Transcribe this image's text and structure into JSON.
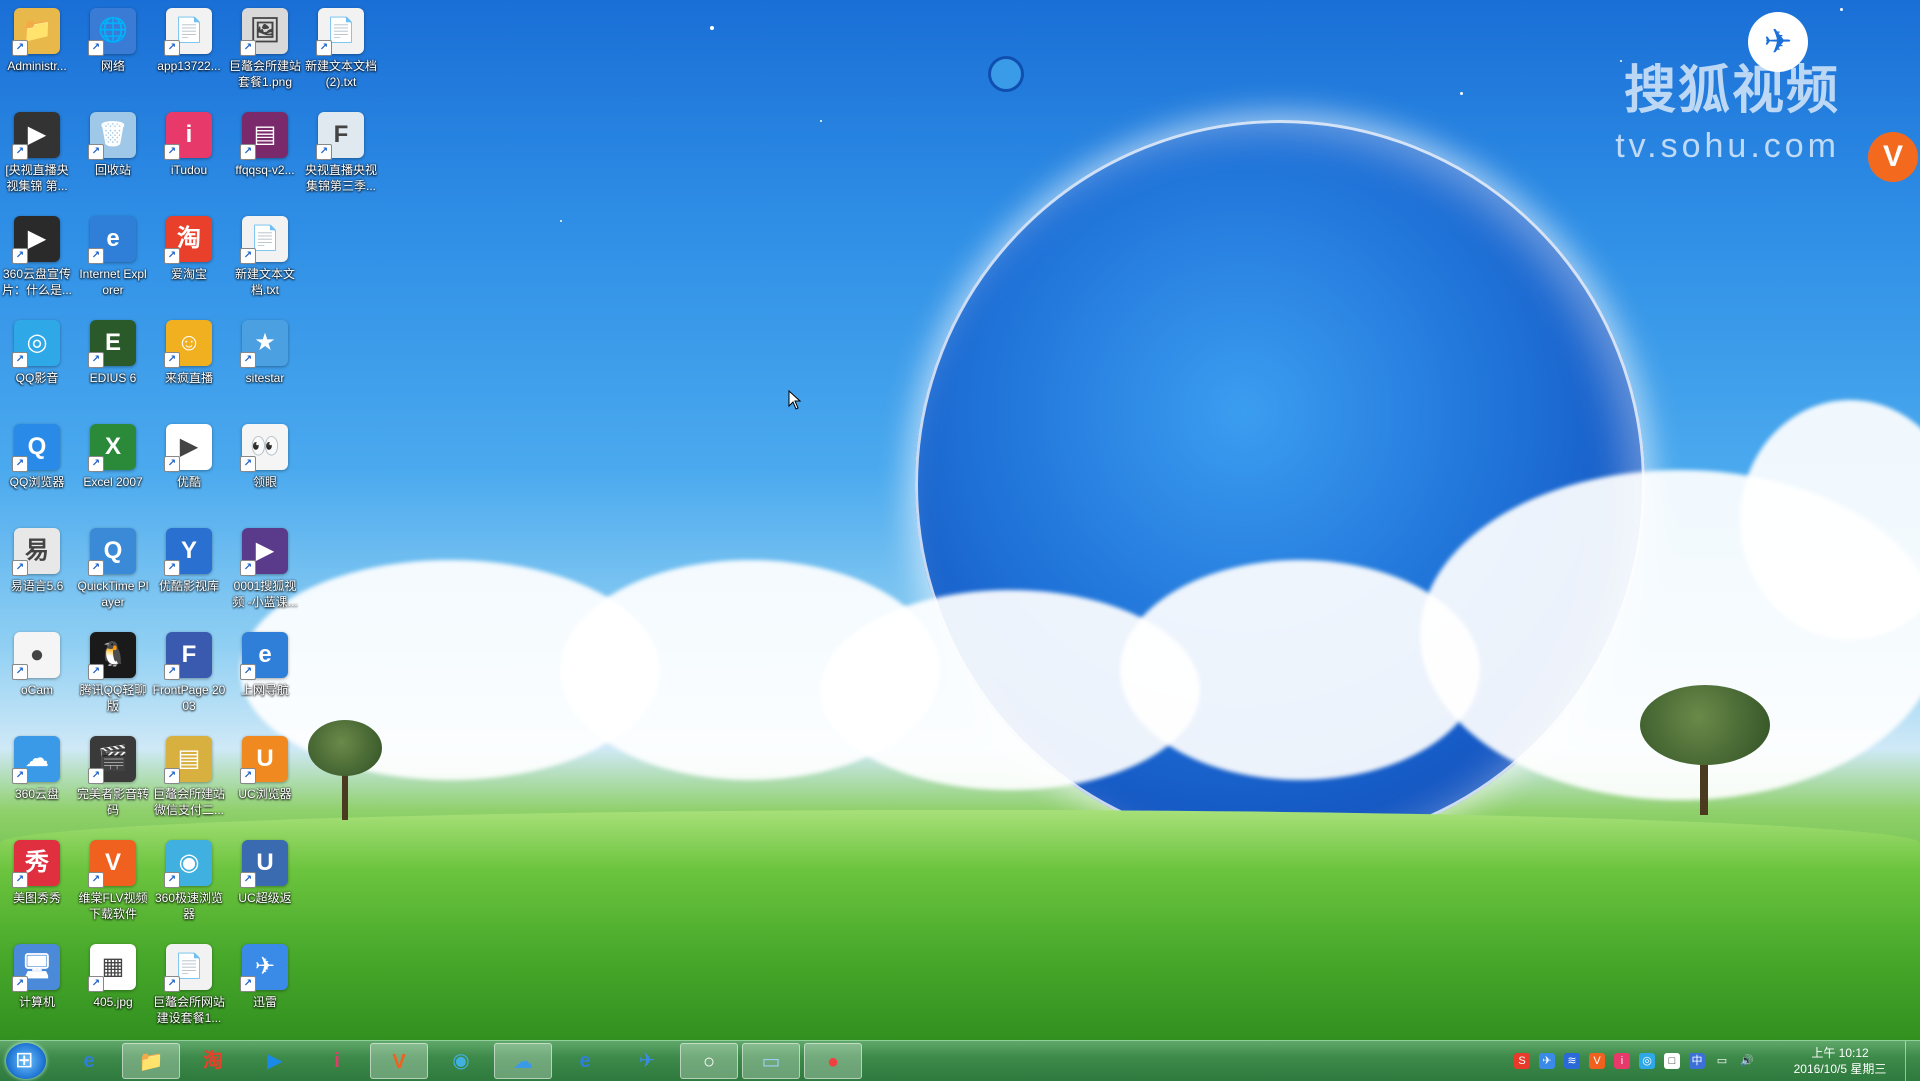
{
  "watermark": {
    "title": "搜狐视频",
    "url": "tv.sohu.com"
  },
  "desktop_icons": [
    {
      "label": "Administr...",
      "icon": "folder-icon",
      "color": "#e8b84a",
      "glyph": "📁"
    },
    {
      "label": "网络",
      "icon": "network-icon",
      "color": "#3a7bd5",
      "glyph": "🌐"
    },
    {
      "label": "app13722...",
      "icon": "file-icon",
      "color": "#f2f2f2",
      "glyph": "📄"
    },
    {
      "label": "巨鼇会所建站套餐1.png",
      "icon": "image-file-icon",
      "color": "#d9d9d9",
      "glyph": "🖼"
    },
    {
      "label": "新建文本文档(2).txt",
      "icon": "text-file-icon",
      "color": "#f2f2f2",
      "glyph": "📄"
    },
    {
      "label": "[央视直播央视集锦 第...",
      "icon": "video-file-icon",
      "color": "#333333",
      "glyph": "▶"
    },
    {
      "label": "回收站",
      "icon": "recycle-bin-icon",
      "color": "#9fc7e8",
      "glyph": "🗑"
    },
    {
      "label": "iTudou",
      "icon": "itudou-icon",
      "color": "#e83a6a",
      "glyph": "i"
    },
    {
      "label": "ffqqsq-v2...",
      "icon": "archive-icon",
      "color": "#7a2a6a",
      "glyph": "▤"
    },
    {
      "label": "央视直播央视集锦第三季...",
      "icon": "flv-file-icon",
      "color": "#e0e8f0",
      "glyph": "F"
    },
    {
      "label": "360云盘宣传片：什么是...",
      "icon": "video-file-icon",
      "color": "#2a2a2a",
      "glyph": "▶"
    },
    {
      "label": "Internet Explorer",
      "icon": "ie-icon",
      "color": "#2f7fd8",
      "glyph": "e"
    },
    {
      "label": "爱淘宝",
      "icon": "taobao-icon",
      "color": "#e8402a",
      "glyph": "淘"
    },
    {
      "label": "新建文本文档.txt",
      "icon": "text-file-icon",
      "color": "#f2f2f2",
      "glyph": "📄"
    },
    {
      "label": "QQ影音",
      "icon": "qq-player-icon",
      "color": "#2fa8e8",
      "glyph": "◎"
    },
    {
      "label": "EDIUS 6",
      "icon": "edius-icon",
      "color": "#2a5a2a",
      "glyph": "E"
    },
    {
      "label": "来疯直播",
      "icon": "laifeng-icon",
      "color": "#f0b020",
      "glyph": "☺"
    },
    {
      "label": "sitestar",
      "icon": "sitestar-icon",
      "color": "#4aa0e0",
      "glyph": "★"
    },
    {
      "label": "QQ浏览器",
      "icon": "qq-browser-icon",
      "color": "#2a8ae8",
      "glyph": "Q"
    },
    {
      "label": "Excel 2007",
      "icon": "excel-icon",
      "color": "#2a8a3a",
      "glyph": "X"
    },
    {
      "label": "优酷",
      "icon": "youku-icon",
      "color": "#ffffff",
      "glyph": "▶"
    },
    {
      "label": "领眼",
      "icon": "lingyan-icon",
      "color": "#f5f5f5",
      "glyph": "👀"
    },
    {
      "label": "易语言5.6",
      "icon": "eyuyan-icon",
      "color": "#e8e8e8",
      "glyph": "易"
    },
    {
      "label": "QuickTime Player",
      "icon": "quicktime-icon",
      "color": "#3a8ad8",
      "glyph": "Q"
    },
    {
      "label": "优酷影视库",
      "icon": "youku-library-icon",
      "color": "#2a70d0",
      "glyph": "Y"
    },
    {
      "label": "0001搜狐视频 -小蓝课...",
      "icon": "video-file-icon",
      "color": "#5a3a8a",
      "glyph": "▶"
    },
    {
      "label": "oCam",
      "icon": "ocam-icon",
      "color": "#f5f5f5",
      "glyph": "●"
    },
    {
      "label": "腾讯QQ轻聊版",
      "icon": "qq-icon",
      "color": "#1a1a1a",
      "glyph": "🐧"
    },
    {
      "label": "FrontPage 2003",
      "icon": "frontpage-icon",
      "color": "#3a5ab0",
      "glyph": "F"
    },
    {
      "label": "上网导航",
      "icon": "ie-icon",
      "color": "#2f7fd8",
      "glyph": "e"
    },
    {
      "label": "360云盘",
      "icon": "cloud-drive-icon",
      "color": "#3a9ae8",
      "glyph": "☁"
    },
    {
      "label": "完美者影音转码",
      "icon": "clapperboard-icon",
      "color": "#3a3a3a",
      "glyph": "🎬"
    },
    {
      "label": "巨鼇会所建站微信支付二...",
      "icon": "archive-icon",
      "color": "#d8b040",
      "glyph": "▤"
    },
    {
      "label": "UC浏览器",
      "icon": "uc-browser-icon",
      "color": "#f08a20",
      "glyph": "U"
    },
    {
      "label": "美图秀秀",
      "icon": "meitu-icon",
      "color": "#e03040",
      "glyph": "秀"
    },
    {
      "label": "维棠FLV视频下载软件",
      "icon": "weitang-icon",
      "color": "#f0601f",
      "glyph": "V"
    },
    {
      "label": "360极速浏览器",
      "icon": "360-browser-icon",
      "color": "#40b0e0",
      "glyph": "◉"
    },
    {
      "label": "UC超级返",
      "icon": "uc-super-icon",
      "color": "#3a6ab0",
      "glyph": "U"
    },
    {
      "label": "计算机",
      "icon": "computer-icon",
      "color": "#4a8ad8",
      "glyph": "🖥"
    },
    {
      "label": "405.jpg",
      "icon": "qr-image-icon",
      "color": "#ffffff",
      "glyph": "▦"
    },
    {
      "label": "巨鼇会所网站建设套餐1...",
      "icon": "text-file-icon",
      "color": "#f2f2f2",
      "glyph": "📄"
    },
    {
      "label": "迅雷",
      "icon": "xunlei-icon",
      "color": "#3a8ae8",
      "glyph": "✈"
    }
  ],
  "taskbar": {
    "items": [
      {
        "name": "ie-taskbar-icon",
        "glyph": "e",
        "color": "#2f7fd8",
        "active": false
      },
      {
        "name": "explorer-taskbar-icon",
        "glyph": "📁",
        "color": "#e8b84a",
        "active": true
      },
      {
        "name": "taobao-taskbar-icon",
        "glyph": "淘",
        "color": "#e8402a",
        "active": false
      },
      {
        "name": "youku-taskbar-icon",
        "glyph": "▶",
        "color": "#1a8ae8",
        "active": false
      },
      {
        "name": "itudou-taskbar-icon",
        "glyph": "i",
        "color": "#e83a6a",
        "active": false
      },
      {
        "name": "weitang-taskbar-icon",
        "glyph": "V",
        "color": "#f0601f",
        "active": true
      },
      {
        "name": "360-browser-taskbar-icon",
        "glyph": "◉",
        "color": "#40b0e0",
        "active": false
      },
      {
        "name": "cloud-drive-taskbar-icon",
        "glyph": "☁",
        "color": "#3a9ae8",
        "active": true
      },
      {
        "name": "ie2-taskbar-icon",
        "glyph": "e",
        "color": "#2f7fd8",
        "active": false
      },
      {
        "name": "xunlei-taskbar-icon",
        "glyph": "✈",
        "color": "#3a8ae8",
        "active": false
      },
      {
        "name": "blank-window-taskbar-icon",
        "glyph": "○",
        "color": "#ffffff",
        "active": true
      },
      {
        "name": "notepad-taskbar-icon",
        "glyph": "▭",
        "color": "#9ad0f0",
        "active": true
      },
      {
        "name": "ocam-taskbar-icon",
        "glyph": "●",
        "color": "#f04040",
        "active": true
      }
    ],
    "clock": {
      "time": "上午 10:12",
      "date": "2016/10/5 星期三"
    }
  }
}
